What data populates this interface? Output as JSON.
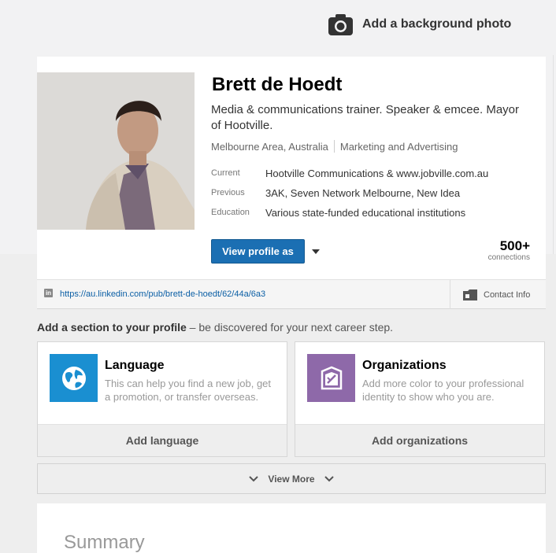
{
  "background": {
    "add_photo_label": "Add a background photo",
    "camera_icon": "camera-icon"
  },
  "profile": {
    "name": "Brett de Hoedt",
    "headline": "Media & communications trainer. Speaker & emcee. Mayor of Hootville.",
    "location": "Melbourne Area, Australia",
    "industry": "Marketing and Advertising",
    "details": [
      {
        "key": "Current",
        "value": "Hootville Communications & www.jobville.com.au"
      },
      {
        "key": "Previous",
        "value": "3AK, Seven Network Melbourne, New Idea"
      },
      {
        "key": "Education",
        "value": "Various state-funded educational institutions"
      }
    ],
    "view_profile_label": "View profile as",
    "connections_count": "500+",
    "connections_label": "connections",
    "public_url": "https://au.linkedin.com/pub/brett-de-hoedt/62/44a/6a3",
    "linkedin_icon_text": "in",
    "contact_label": "Contact Info"
  },
  "add_section": {
    "bold": "Add a section to your profile",
    "rest": " – be discovered for your next career step."
  },
  "suggestions": [
    {
      "title": "Language",
      "description": "This can help you find a new job, get a promotion, or transfer overseas.",
      "action": "Add language",
      "icon": "globe-icon",
      "color": "#1a8fd1"
    },
    {
      "title": "Organizations",
      "description": "Add more color to your professional identity to show who you are.",
      "action": "Add organizations",
      "icon": "badge-icon",
      "color": "#8e69a9"
    }
  ],
  "view_more_label": "View More",
  "summary": {
    "title": "Summary"
  },
  "colors": {
    "primary_button": "#1b6fb3",
    "link": "#0b5fa5"
  }
}
